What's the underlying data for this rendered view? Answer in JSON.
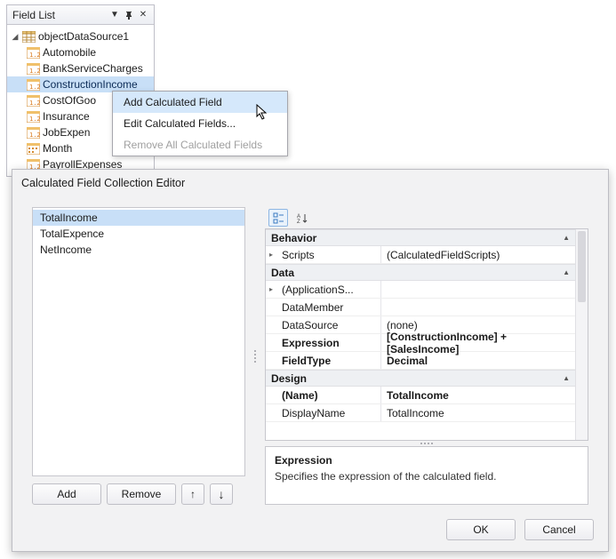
{
  "fieldList": {
    "title": "Field List",
    "dataSource": "objectDataSource1",
    "fields": [
      {
        "label": "Automobile",
        "icon": "num"
      },
      {
        "label": "BankServiceCharges",
        "icon": "num"
      },
      {
        "label": "ConstructionIncome",
        "icon": "num",
        "selected": true
      },
      {
        "label": "CostOfGoodsSold",
        "icon": "num",
        "truncated": "CostOfGoo"
      },
      {
        "label": "Insurance",
        "icon": "num"
      },
      {
        "label": "JobExpenses",
        "icon": "num",
        "truncated": "JobExpen"
      },
      {
        "label": "Month",
        "icon": "cal"
      },
      {
        "label": "PayrollExpenses",
        "icon": "num"
      }
    ]
  },
  "contextMenu": {
    "items": [
      {
        "label": "Add Calculated Field",
        "highlight": true
      },
      {
        "label": "Edit Calculated Fields..."
      },
      {
        "label": "Remove All Calculated Fields",
        "disabled": true
      }
    ]
  },
  "editor": {
    "title": "Calculated Field Collection Editor",
    "listItems": [
      {
        "label": "TotalIncome",
        "selected": true
      },
      {
        "label": "TotalExpence"
      },
      {
        "label": "NetIncome"
      }
    ],
    "buttons": {
      "add": "Add",
      "remove": "Remove",
      "up": "↑",
      "down": "↓"
    },
    "propGrid": {
      "categories": [
        {
          "name": "Behavior",
          "rows": [
            {
              "key": "Scripts",
              "val": "(CalculatedFieldScripts)",
              "expander": true
            }
          ]
        },
        {
          "name": "Data",
          "rows": [
            {
              "key": "(ApplicationS...",
              "val": "",
              "expander": true
            },
            {
              "key": "DataMember",
              "val": ""
            },
            {
              "key": "DataSource",
              "val": "(none)"
            },
            {
              "key": "Expression",
              "val": "[ConstructionIncome] + [SalesIncome]",
              "bold": true
            },
            {
              "key": "FieldType",
              "val": "Decimal",
              "bold": true
            }
          ]
        },
        {
          "name": "Design",
          "rows": [
            {
              "key": "(Name)",
              "val": "TotalIncome",
              "bold": true
            },
            {
              "key": "DisplayName",
              "val": "TotalIncome"
            }
          ]
        }
      ]
    },
    "description": {
      "title": "Expression",
      "text": "Specifies the expression of the calculated field."
    },
    "dlgButtons": {
      "ok": "OK",
      "cancel": "Cancel"
    }
  }
}
